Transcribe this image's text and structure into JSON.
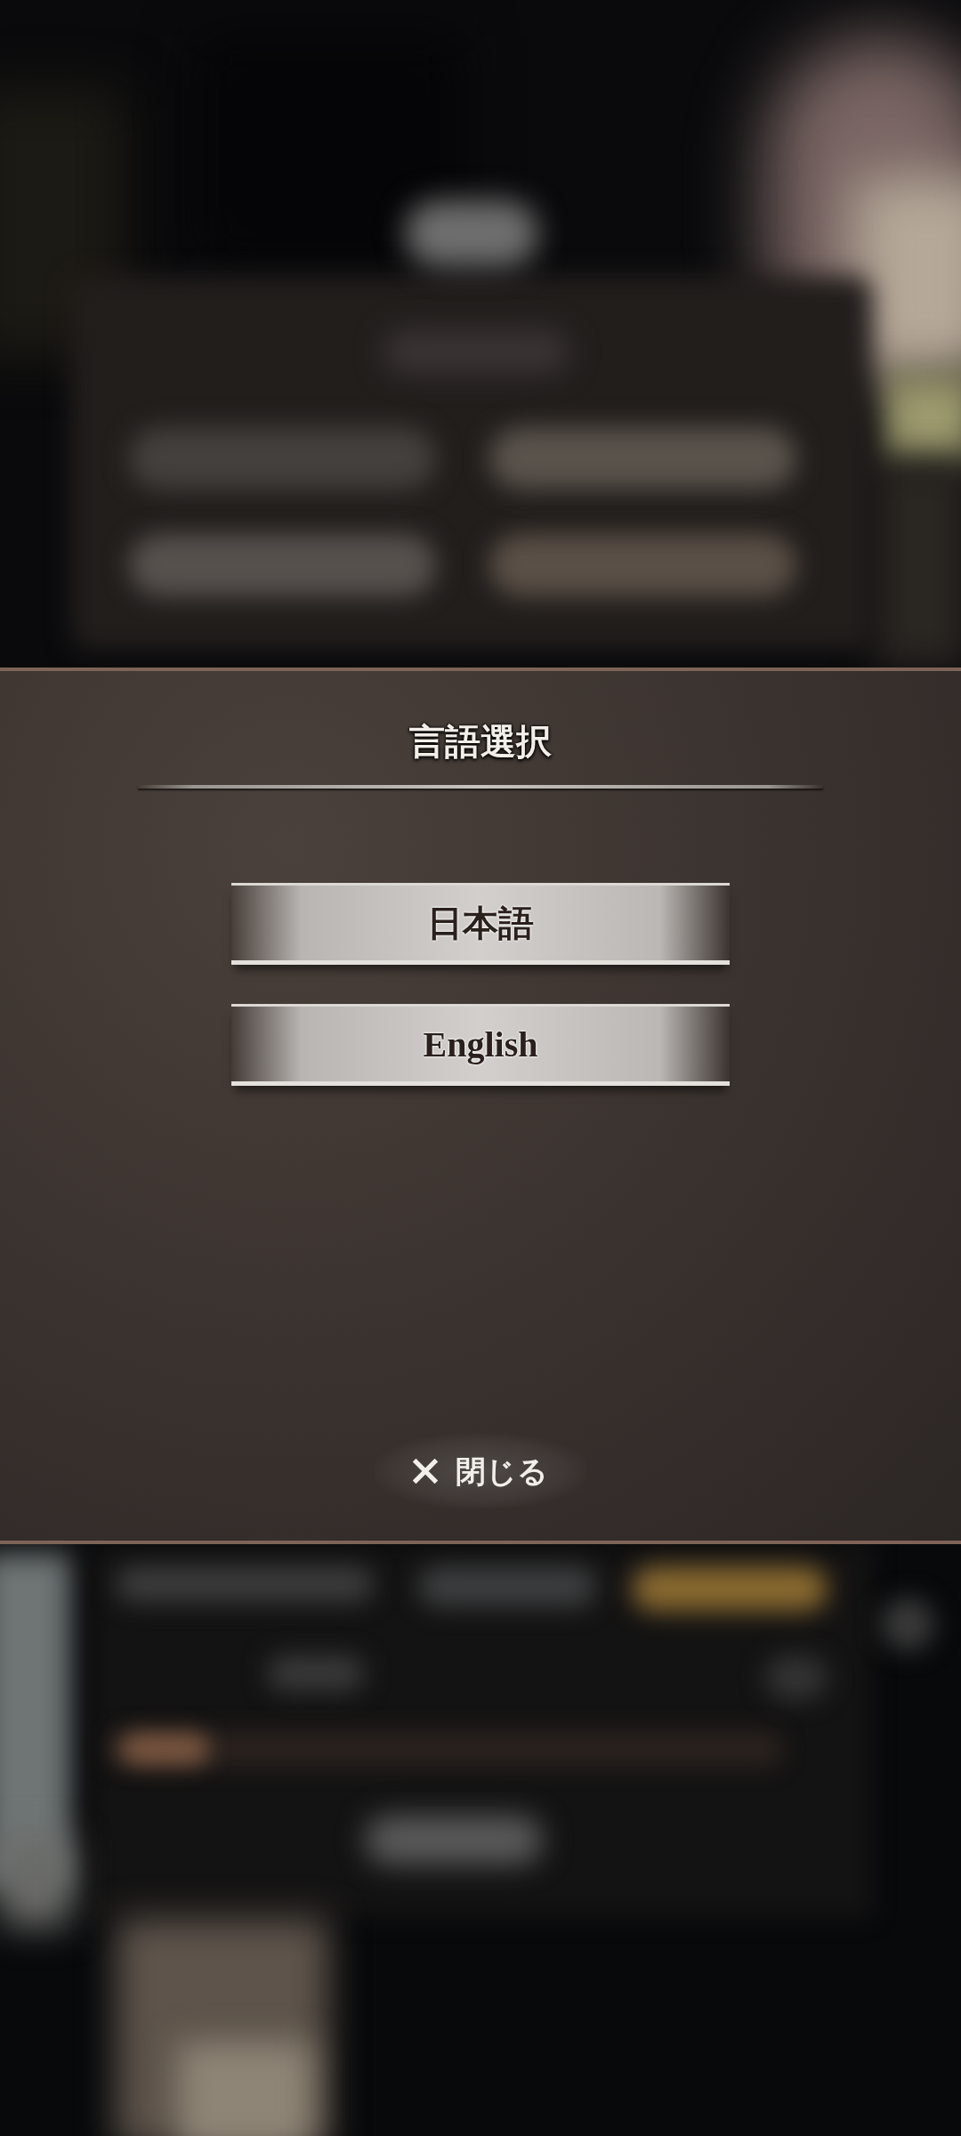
{
  "dialog": {
    "title": "言語選択",
    "options": [
      {
        "label": "日本語"
      },
      {
        "label": "English"
      }
    ],
    "close": {
      "label": "閉じる"
    }
  }
}
